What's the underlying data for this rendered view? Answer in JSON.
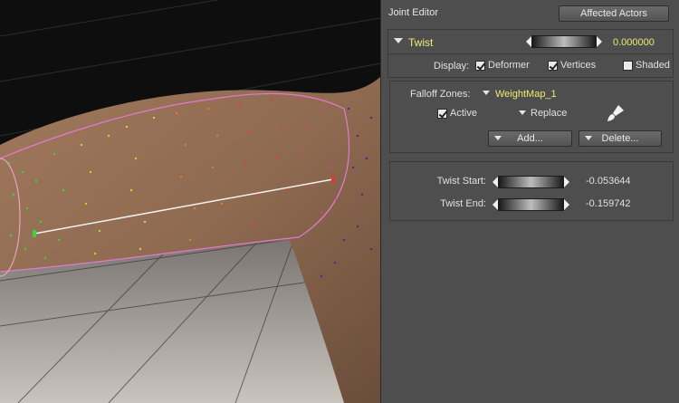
{
  "panel": {
    "title": "Joint Editor",
    "affected_actors_label": "Affected Actors"
  },
  "twist": {
    "header_label": "Twist",
    "value": "0.000000",
    "display_label": "Display:",
    "display_options": {
      "deformer": {
        "label": "Deformer",
        "checked": true
      },
      "vertices": {
        "label": "Vertices",
        "checked": true
      },
      "shaded": {
        "label": "Shaded",
        "checked": false
      }
    }
  },
  "falloff": {
    "label": "Falloff Zones:",
    "weightmap": "WeightMap_1",
    "active": {
      "label": "Active",
      "checked": true
    },
    "replace_label": "Replace",
    "add_label": "Add...",
    "delete_label": "Delete..."
  },
  "twist_params": {
    "start_label": "Twist Start:",
    "start_value": "-0.053644",
    "end_label": "Twist End:",
    "end_value": "-0.159742"
  },
  "colors": {
    "panel_bg": "#4e4e4e",
    "accent_yellow": "#ecec70"
  }
}
